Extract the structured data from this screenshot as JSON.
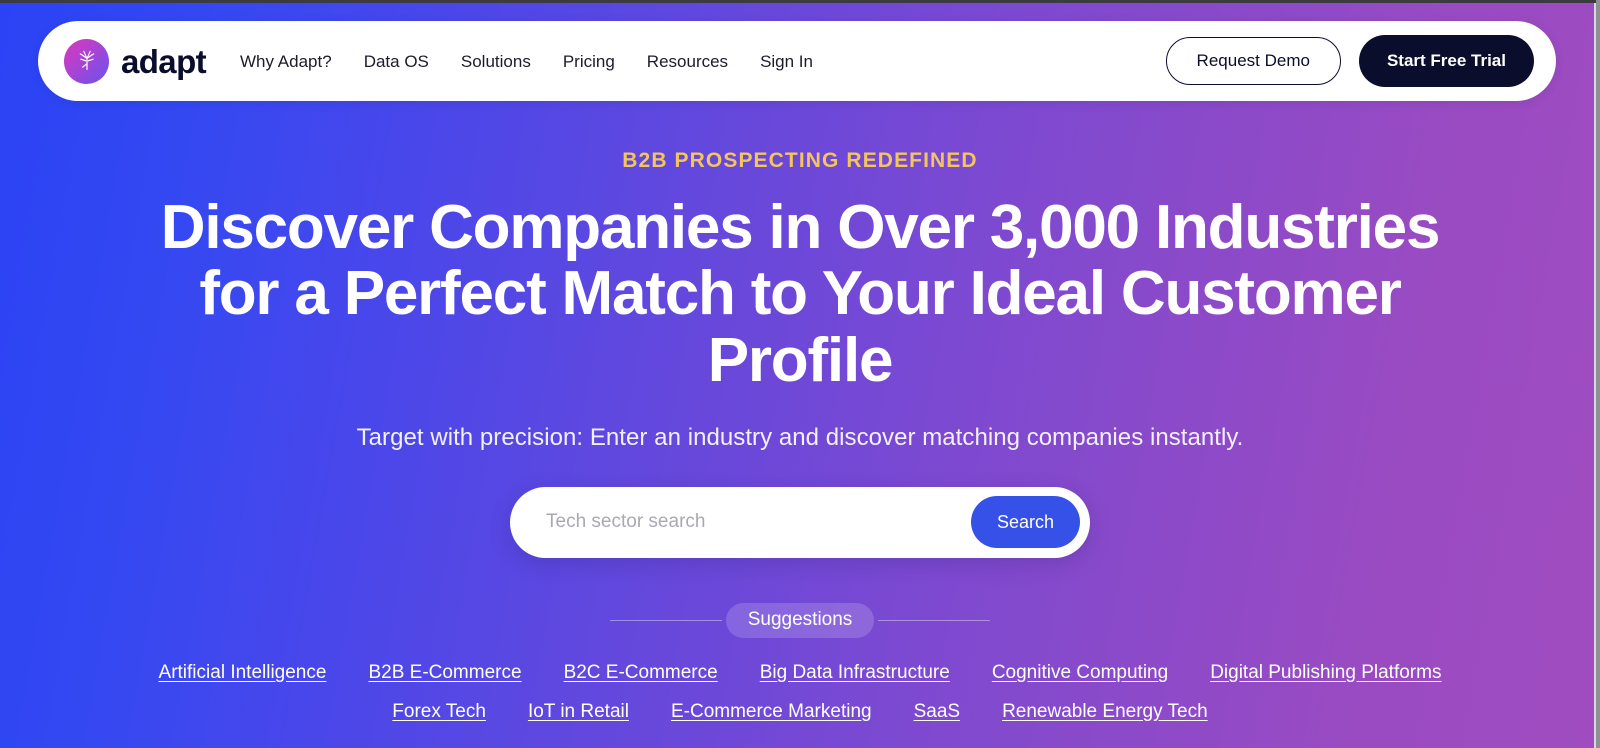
{
  "brand": {
    "name": "adapt",
    "logo_icon": "adapt-tree-mark",
    "gradient_from": "#d43bbd",
    "gradient_to": "#6a53ef"
  },
  "nav": {
    "links": [
      {
        "label": "Why Adapt?"
      },
      {
        "label": "Data OS"
      },
      {
        "label": "Solutions"
      },
      {
        "label": "Pricing"
      },
      {
        "label": "Resources"
      },
      {
        "label": "Sign In"
      }
    ],
    "demo_button": "Request Demo",
    "trial_button": "Start Free Trial"
  },
  "hero": {
    "eyebrow": "B2B PROSPECTING REDEFINED",
    "headline": "Discover Companies in Over 3,000 Industries for a Perfect Match to Your Ideal Customer Profile",
    "subhead": "Target with precision: Enter an industry and discover matching companies instantly."
  },
  "search": {
    "value": "",
    "placeholder": "Tech sector search",
    "button_label": "Search",
    "button_color": "#3651e8"
  },
  "suggestions": {
    "label": "Suggestions",
    "row1": [
      {
        "label": "Artificial Intelligence"
      },
      {
        "label": "B2B E-Commerce"
      },
      {
        "label": "B2C E-Commerce"
      },
      {
        "label": "Big Data Infrastructure"
      },
      {
        "label": "Cognitive Computing"
      },
      {
        "label": "Digital Publishing Platforms"
      }
    ],
    "row2": [
      {
        "label": "Forex Tech"
      },
      {
        "label": "IoT in Retail"
      },
      {
        "label": "E-Commerce Marketing"
      },
      {
        "label": "SaaS"
      },
      {
        "label": "Renewable Energy Tech"
      }
    ]
  },
  "theme": {
    "bg_gradient_from": "#2b43f5",
    "bg_gradient_to": "#a04cc0",
    "eyebrow_color": "#f3c55c",
    "dark_navy": "#0b0d2c"
  }
}
